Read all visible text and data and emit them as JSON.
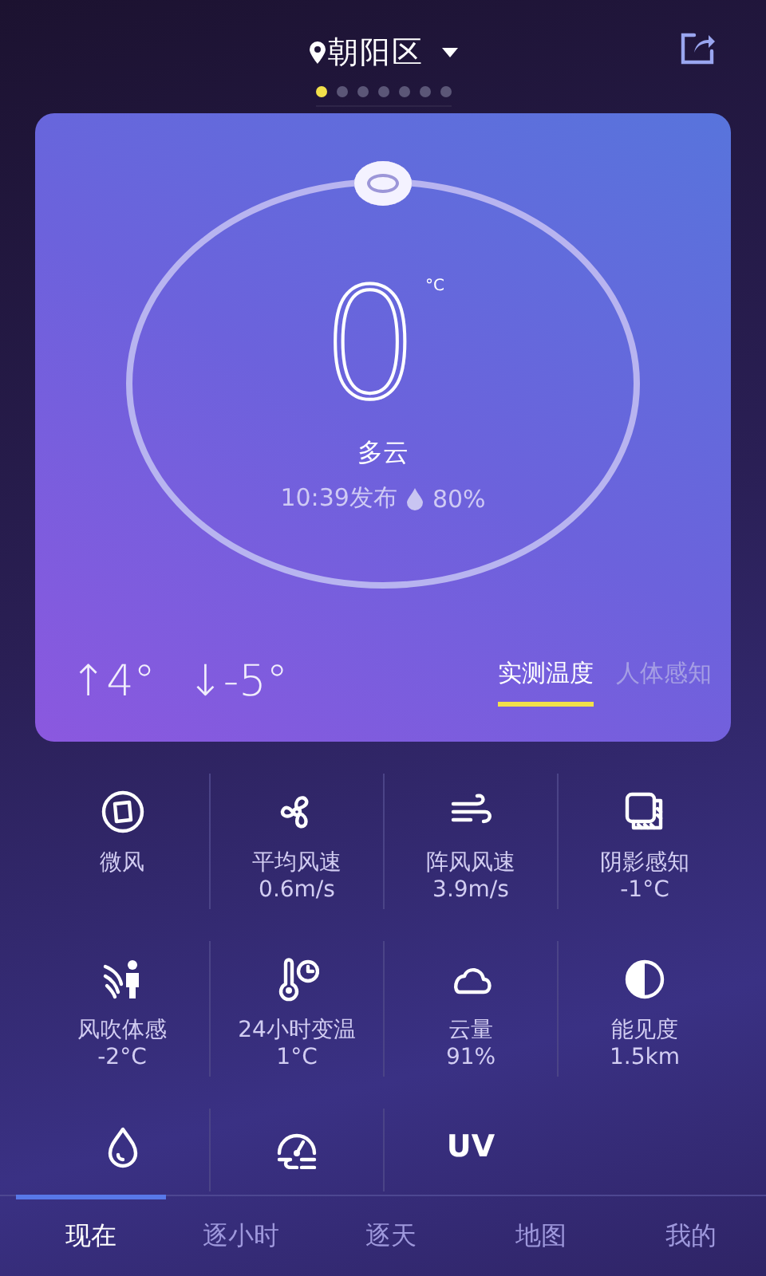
{
  "header": {
    "location": "朝阳区",
    "pages": [
      {
        "selected": true
      },
      {
        "selected": false
      },
      {
        "selected": false
      },
      {
        "selected": false
      },
      {
        "selected": false
      },
      {
        "selected": false
      },
      {
        "selected": false
      }
    ]
  },
  "current": {
    "temperature": "0",
    "unit": "°C",
    "condition": "多云",
    "published": "10:39发布",
    "humidity": "80%",
    "high": "↑4°",
    "low": "↓-5°",
    "modes": [
      {
        "label": "实测温度",
        "selected": true
      },
      {
        "label": "人体感知",
        "selected": false
      }
    ]
  },
  "details": [
    {
      "kind": "compass",
      "label": "微风"
    },
    {
      "kind": "fan",
      "label": "平均风速",
      "value": "0.6m/s"
    },
    {
      "kind": "wind",
      "label": "阵风风速",
      "value": "3.9m/s"
    },
    {
      "kind": "shade",
      "label": "阴影感知",
      "value": "-1°C"
    },
    {
      "kind": "windperson",
      "label": "风吹体感",
      "value": "-2°C"
    },
    {
      "kind": "thermoclock",
      "label": "24小时变温",
      "value": "1°C"
    },
    {
      "kind": "cloud",
      "label": "云量",
      "value": "91%"
    },
    {
      "kind": "contrast",
      "label": "能见度",
      "value": "1.5km"
    },
    {
      "kind": "drop"
    },
    {
      "kind": "gauge"
    },
    {
      "kind": "text",
      "text": "UV"
    }
  ],
  "tabs": [
    {
      "label": "现在",
      "selected": true
    },
    {
      "label": "逐小时",
      "selected": false
    },
    {
      "label": "逐天",
      "selected": false
    },
    {
      "label": "地图",
      "selected": false
    },
    {
      "label": "我的",
      "selected": false
    }
  ]
}
